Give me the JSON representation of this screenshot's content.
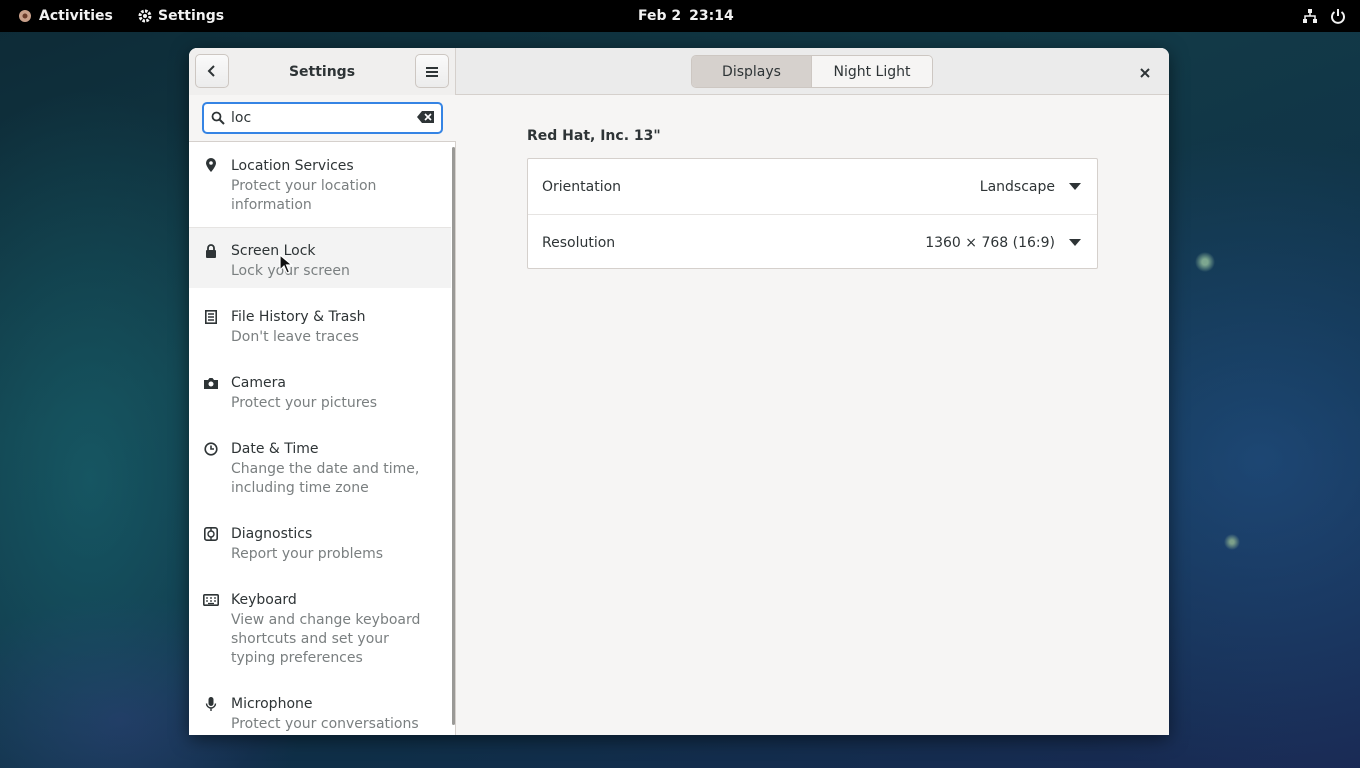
{
  "topbar": {
    "activities": "Activities",
    "app_name": "Settings",
    "date": "Feb 2",
    "time": "23:14",
    "icons": [
      "network-icon",
      "power-icon"
    ]
  },
  "window": {
    "sidebar_title": "Settings",
    "tabs": [
      {
        "label": "Displays",
        "active": true
      },
      {
        "label": "Night Light",
        "active": false
      }
    ]
  },
  "search": {
    "value": "loc",
    "placeholder": ""
  },
  "results": [
    {
      "title": "Location Services",
      "subtitle": "Protect your location information",
      "icon": "location-pin-icon"
    },
    {
      "title": "Screen Lock",
      "subtitle": "Lock your screen",
      "icon": "lock-icon"
    },
    {
      "title": "File History & Trash",
      "subtitle": "Don't leave traces",
      "icon": "file-history-icon"
    },
    {
      "title": "Camera",
      "subtitle": "Protect your pictures",
      "icon": "camera-icon"
    },
    {
      "title": "Date & Time",
      "subtitle": "Change the date and time, including time zone",
      "icon": "clock-icon"
    },
    {
      "title": "Diagnostics",
      "subtitle": "Report your problems",
      "icon": "diagnostics-icon"
    },
    {
      "title": "Keyboard",
      "subtitle": "View and change keyboard shortcuts and set your typing preferences",
      "icon": "keyboard-icon"
    },
    {
      "title": "Microphone",
      "subtitle": "Protect your conversations",
      "icon": "microphone-icon"
    }
  ],
  "display": {
    "monitor": "Red Hat, Inc. 13\"",
    "orientation_label": "Orientation",
    "orientation_value": "Landscape",
    "resolution_label": "Resolution",
    "resolution_value": "1360 × 768 (16:9)"
  },
  "colors": {
    "accent": "#3584e4",
    "topbar": "#000000",
    "window_bg": "#f6f5f4"
  }
}
